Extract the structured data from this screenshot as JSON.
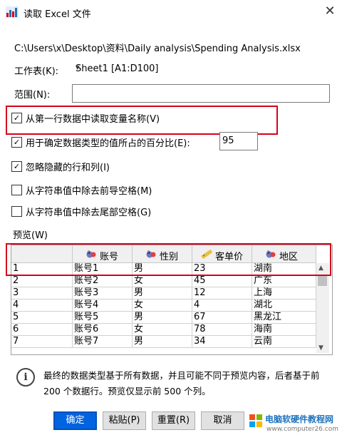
{
  "window": {
    "title": "读取 Excel 文件",
    "close_glyph": "✕"
  },
  "file_path": "C:\\Users\\x\\Desktop\\资料\\Daily analysis\\Spending  Analysis.xlsx",
  "worksheet": {
    "label": "工作表(K):",
    "value": "Sheet1 [A1:D100]"
  },
  "range": {
    "label": "范围(N):",
    "value": ""
  },
  "options": [
    {
      "label": "从第一行数据中读取变量名称(V)",
      "checked": true
    },
    {
      "label": "用于确定数据类型的值所占的百分比(E):",
      "checked": true,
      "value": "95"
    },
    {
      "label": "忽略隐藏的行和列(I)",
      "checked": true
    },
    {
      "label": "从字符串值中除去前导空格(M)",
      "checked": false
    },
    {
      "label": "从字符串值中除去尾部空格(G)",
      "checked": false
    }
  ],
  "preview": {
    "label": "预览(W)",
    "columns": [
      {
        "name": "账号",
        "icon": "string-var-icon"
      },
      {
        "name": "性别",
        "icon": "string-var-icon"
      },
      {
        "name": "客单价",
        "icon": "scale-var-icon"
      },
      {
        "name": "地区",
        "icon": "string-var-icon"
      }
    ],
    "rows": [
      [
        "1",
        "账号1",
        "男",
        "23",
        "湖南"
      ],
      [
        "2",
        "账号2",
        "女",
        "45",
        "广东"
      ],
      [
        "3",
        "账号3",
        "男",
        "12",
        "上海"
      ],
      [
        "4",
        "账号4",
        "女",
        "4",
        "湖北"
      ],
      [
        "5",
        "账号5",
        "男",
        "67",
        "黑龙江"
      ],
      [
        "6",
        "账号6",
        "女",
        "78",
        "海南"
      ],
      [
        "7",
        "账号7",
        "男",
        "34",
        "云南"
      ]
    ]
  },
  "info_text": "最终的数据类型基于所有数据，并且可能不同于预览内容，后者基于前 200 个数据行。预览仅显示前 500 个列。",
  "buttons": {
    "ok": "确定",
    "paste": "粘贴(P)",
    "reset": "重置(R)",
    "cancel": "取消"
  },
  "watermark": {
    "line1": "电脑软硬件教程网",
    "line2": "www.computer26.com"
  },
  "colors": {
    "accent": "#0063e1",
    "highlight_border": "#d6001c"
  }
}
